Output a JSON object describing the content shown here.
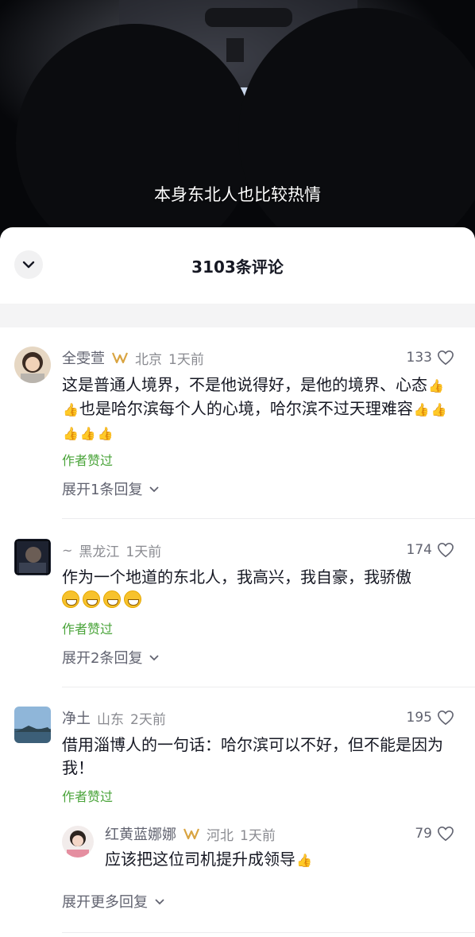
{
  "video": {
    "caption": "本身东北人也比较热情"
  },
  "sheet": {
    "title": "3103条评论"
  },
  "comments": [
    {
      "user": "全雯萱",
      "location": "北京",
      "time": "1天前",
      "likes": "133",
      "text": "这是普通人境界，不是他说得好，是他的境界、心态",
      "text_mid": "也是哈尔滨每个人的心境，哈尔滨不过天理难容",
      "author_liked": "作者赞过",
      "expand": "展开1条回复"
    },
    {
      "user": "~",
      "location": "黑龙江",
      "time": "1天前",
      "likes": "174",
      "text": "作为一个地道的东北人，我高兴，我自豪，我骄傲",
      "author_liked": "作者赞过",
      "expand": "展开2条回复"
    },
    {
      "user": "净土",
      "location": "山东",
      "time": "2天前",
      "likes": "195",
      "text": "借用淄博人的一句话：哈尔滨可以不好，但不能是因为我！",
      "author_liked": "作者赞过",
      "reply": {
        "user": "红黄蓝娜娜",
        "location": "河北",
        "time": "1天前",
        "likes": "79",
        "text": "应该把这位司机提升成领导"
      },
      "expand": "展开更多回复"
    }
  ],
  "colors": {
    "author_liked": "#4aa43a",
    "meta": "#8a8b91",
    "badge": "#d9a441"
  },
  "icons": [
    "chevron-down-icon",
    "heart-icon",
    "thumbs-up-emoji",
    "grin-emoji",
    "fan-badge-icon"
  ]
}
